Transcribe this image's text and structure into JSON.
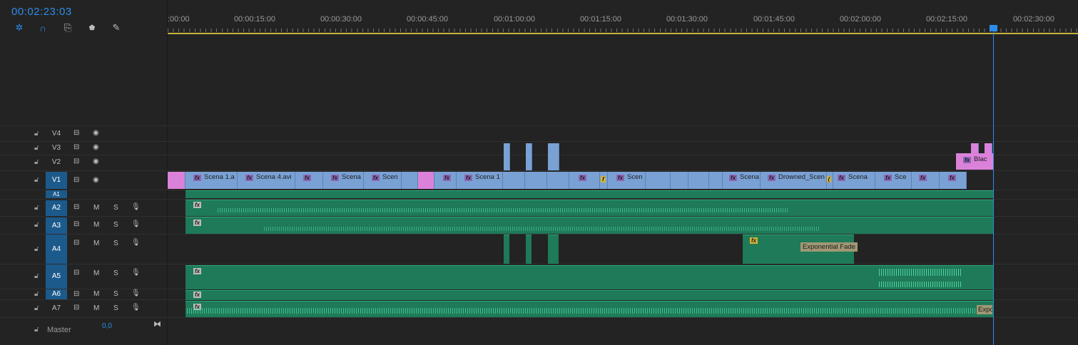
{
  "timecode": "00:02:23:03",
  "toolbar": [
    {
      "name": "snap-icon",
      "glyph": "✲"
    },
    {
      "name": "magnet-icon",
      "glyph": "∩"
    },
    {
      "name": "linked-selection-icon",
      "glyph": "⎘"
    },
    {
      "name": "marker-icon",
      "glyph": "⬟"
    },
    {
      "name": "wrench-icon",
      "glyph": "🔧"
    }
  ],
  "ruler": {
    "labels": [
      ":00:00",
      "00:00:15:00",
      "00:00:30:00",
      "00:00:45:00",
      "00:01:00:00",
      "00:01:15:00",
      "00:01:30:00",
      "00:01:45:00",
      "00:02:00:00",
      "00:02:15:00",
      "00:02:30:00"
    ]
  },
  "tracks": {
    "video": [
      {
        "id": "V4",
        "active": false
      },
      {
        "id": "V3",
        "active": false
      },
      {
        "id": "V2",
        "active": false
      },
      {
        "id": "V1",
        "active": true
      }
    ],
    "audio": [
      {
        "id": "A1",
        "active": true
      },
      {
        "id": "A2",
        "active": true,
        "m": "M",
        "s": "S"
      },
      {
        "id": "A3",
        "active": true,
        "m": "M",
        "s": "S"
      },
      {
        "id": "A4",
        "active": true,
        "m": "M",
        "s": "S"
      },
      {
        "id": "A5",
        "active": true,
        "m": "M",
        "s": "S"
      },
      {
        "id": "A6",
        "active": true,
        "m": "M",
        "s": "S"
      },
      {
        "id": "A7",
        "active": false,
        "m": "M",
        "s": "S"
      }
    ],
    "master": {
      "label": "Master",
      "value": "0,0"
    }
  },
  "v1_clips": [
    {
      "label": "Scena 1.a"
    },
    {
      "label": "Scena 4.avi"
    },
    {
      "label": "Scena"
    },
    {
      "label": "Scen"
    },
    {
      "label": "Scena 1"
    },
    {
      "label": "Scen"
    },
    {
      "label": "Scena"
    },
    {
      "label": "Drowned_Scen"
    },
    {
      "label": "Scena"
    },
    {
      "label": "Sce"
    }
  ],
  "v2_clip": {
    "label": "Blac"
  },
  "a4_clip": {
    "transition": "Exponential Fade"
  },
  "a7_clip": {
    "transition": "Expo"
  },
  "colors": {
    "accent": "#2d8ceb",
    "video": "#7aa1d4",
    "audio": "#1e7a58",
    "pink": "#da82da",
    "work_area": "#c8b23a"
  }
}
